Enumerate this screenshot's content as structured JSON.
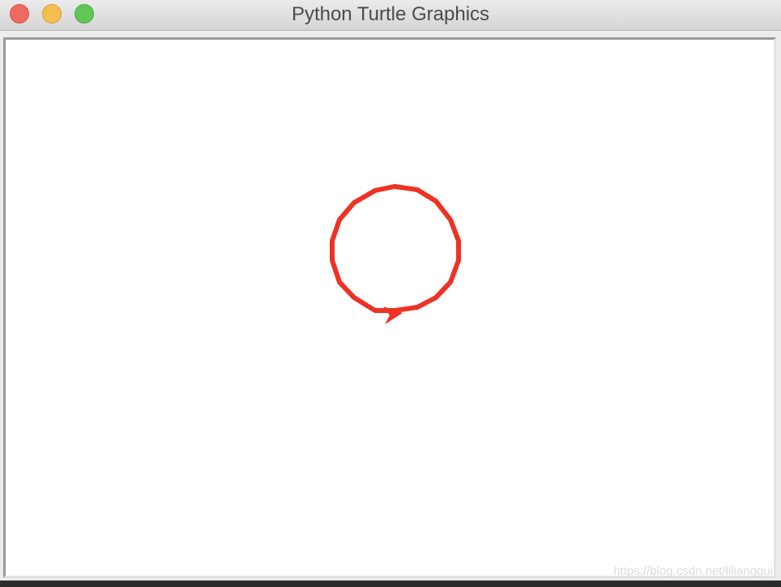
{
  "window": {
    "title": "Python Turtle Graphics",
    "buttons": {
      "close": "close",
      "minimize": "minimize",
      "zoom": "zoom"
    }
  },
  "canvas": {
    "background": "#ffffff",
    "pen_color": "#ee3224",
    "shape": "circle",
    "turtle_shape": "arrow"
  },
  "watermark": "https://blog.csdn.net/lilianggui"
}
